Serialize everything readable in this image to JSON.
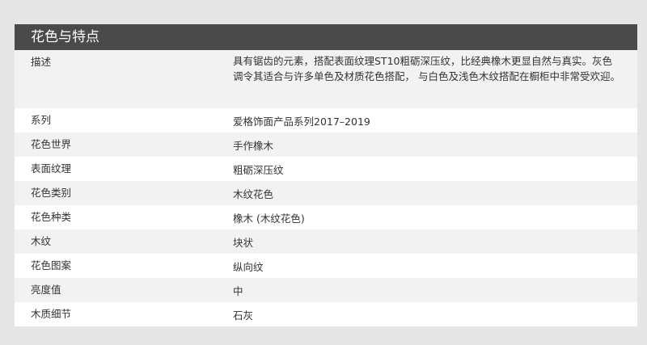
{
  "panel": {
    "title": "花色与特点"
  },
  "rows": [
    {
      "label": "描述",
      "value": "具有锯齿的元素，搭配表面纹理ST10粗砺深压纹，比经典橡木更显自然与真实。灰色调令其适合与许多单色及材质花色搭配， 与白色及浅色木纹搭配在橱柜中非常受欢迎。"
    },
    {
      "label": "系列",
      "value": "爱格饰面产品系列2017–2019"
    },
    {
      "label": "花色世界",
      "value": "手作橡木"
    },
    {
      "label": "表面纹理",
      "value": "粗砺深压纹"
    },
    {
      "label": "花色类别",
      "value": "木纹花色"
    },
    {
      "label": "花色种类",
      "value": "橡木 (木纹花色)"
    },
    {
      "label": "木纹",
      "value": "块状"
    },
    {
      "label": "花色图案",
      "value": "纵向纹"
    },
    {
      "label": "亮度值",
      "value": "中"
    },
    {
      "label": "木质细节",
      "value": "石灰"
    }
  ]
}
